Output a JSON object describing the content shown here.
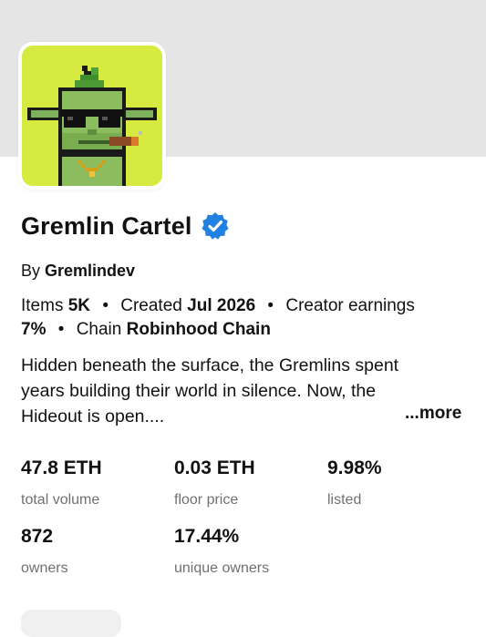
{
  "collection": {
    "name": "Gremlin Cartel",
    "verified": true,
    "by_prefix": "By",
    "creator": "Gremlindev"
  },
  "meta": {
    "items_label": "Items",
    "items_value": "5K",
    "created_label": "Created",
    "created_value": "Jul 2026",
    "earnings_label": "Creator earnings",
    "earnings_value": "7%",
    "chain_label": "Chain",
    "chain_value": "Robinhood Chain",
    "separator": "•"
  },
  "description": {
    "line1": "Hidden beneath the surface, the Gremlins spent",
    "line2": "years building their world in silence. Now, the",
    "line3": "Hideout is open....",
    "more_label": "...more"
  },
  "stats": [
    {
      "value": "47.8 ETH",
      "label": "total volume"
    },
    {
      "value": "0.03 ETH",
      "label": "floor price"
    },
    {
      "value": "9.98%",
      "label": "listed"
    },
    {
      "value": "872",
      "label": "owners"
    },
    {
      "value": "17.44%",
      "label": "unique owners"
    }
  ],
  "colors": {
    "banner": "#e5e5e5",
    "avatar_bg": "#d6ea3f",
    "verified": "#2081e2",
    "muted_text": "#707070"
  },
  "icons": {
    "verified": "verified-badge-icon"
  }
}
